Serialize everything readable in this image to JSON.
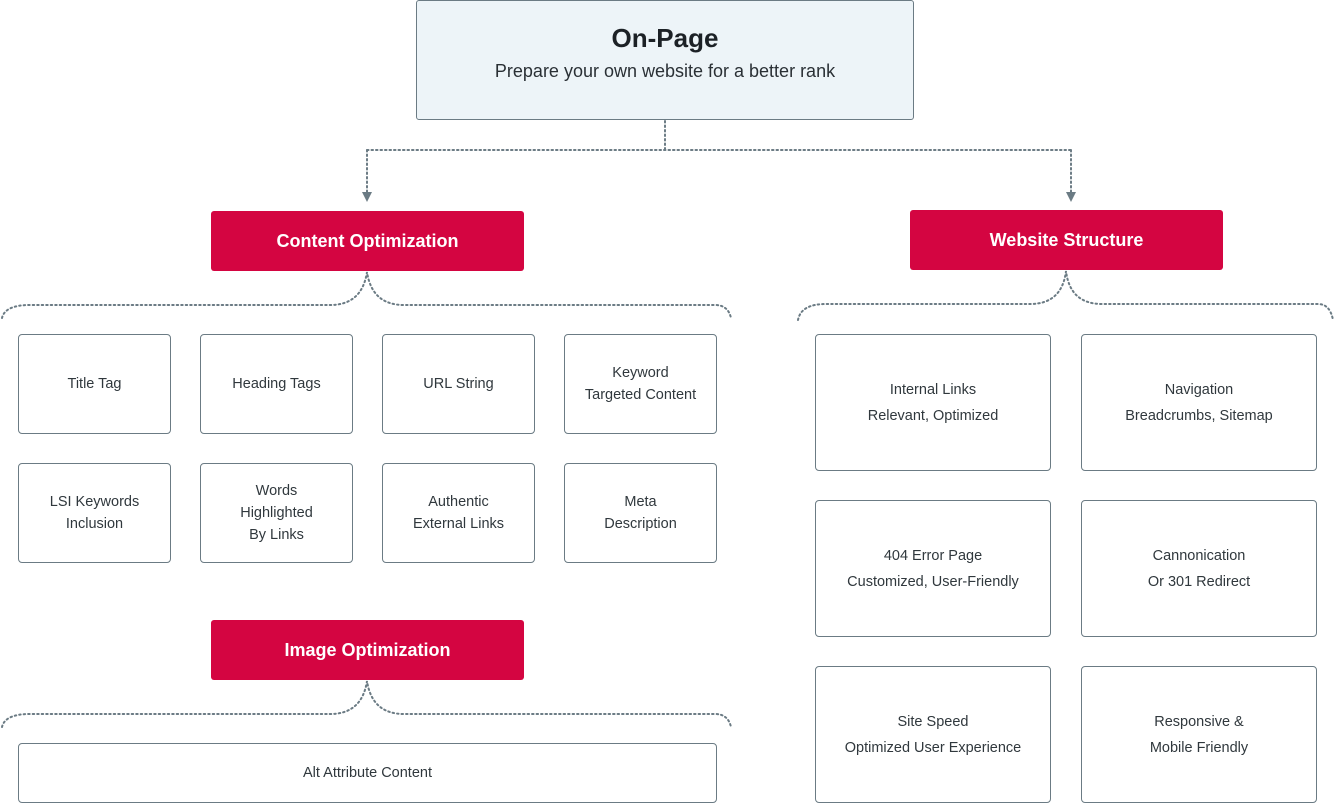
{
  "root": {
    "title": "On-Page",
    "subtitle": "Prepare your own website for a better rank"
  },
  "colors": {
    "category_fill": "#d40541",
    "root_fill": "#edf4f8",
    "border": "#6b7b84",
    "connector": "#6b7b84"
  },
  "content_optimization": {
    "label": "Content Optimization",
    "items": [
      {
        "lines": [
          "Title Tag"
        ]
      },
      {
        "lines": [
          "Heading Tags"
        ]
      },
      {
        "lines": [
          "URL String"
        ]
      },
      {
        "lines": [
          "Keyword",
          "Targeted Content"
        ]
      },
      {
        "lines": [
          "LSI Keywords",
          "Inclusion"
        ]
      },
      {
        "lines": [
          "Words",
          "Highlighted",
          "By Links"
        ]
      },
      {
        "lines": [
          "Authentic",
          "External Links"
        ]
      },
      {
        "lines": [
          "Meta",
          "Description"
        ]
      }
    ]
  },
  "image_optimization": {
    "label": "Image Optimization",
    "items": [
      {
        "lines": [
          "Alt Attribute Content"
        ]
      }
    ]
  },
  "website_structure": {
    "label": "Website Structure",
    "items": [
      {
        "lines": [
          "Internal Links",
          "Relevant, Optimized"
        ]
      },
      {
        "lines": [
          "Navigation",
          "Breadcrumbs, Sitemap"
        ]
      },
      {
        "lines": [
          "404 Error Page",
          "Customized, User-Friendly"
        ]
      },
      {
        "lines": [
          "Cannonication",
          "Or 301 Redirect"
        ]
      },
      {
        "lines": [
          "Site Speed",
          "Optimized User Experience"
        ]
      },
      {
        "lines": [
          "Responsive &",
          "Mobile Friendly"
        ]
      }
    ]
  }
}
